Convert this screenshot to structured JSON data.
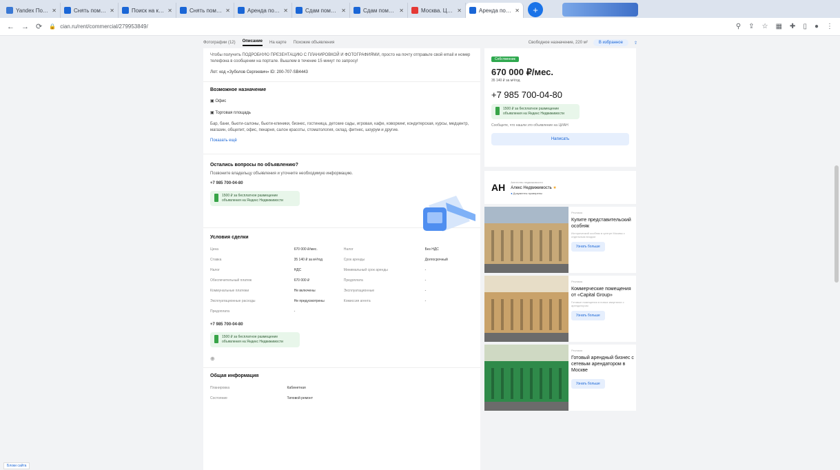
{
  "browser": {
    "tabs": [
      {
        "title": "Yandex Почта",
        "color": "#3a78d4"
      },
      {
        "title": "Снять помещение с...",
        "color": "#1a66d6"
      },
      {
        "title": "Поиск на карте ЦИАН",
        "color": "#1a66d6"
      },
      {
        "title": "Снять помещение с...",
        "color": "#1a66d6"
      },
      {
        "title": "Аренда помещени...",
        "color": "#1a66d6"
      },
      {
        "title": "Сдам помещение...",
        "color": "#1a66d6"
      },
      {
        "title": "Сдам помещение...",
        "color": "#1a66d6"
      },
      {
        "title": "Москва. ЦИАН...",
        "color": "#e53935"
      },
      {
        "title": "Аренда помещен...",
        "color": "#1a66d6"
      }
    ],
    "new_tab": "+",
    "url": "cian.ru/rent/commercial/279953849/"
  },
  "sticky_nav": {
    "items": [
      "Фотографии (12)",
      "Описание",
      "На карте",
      "Похожие объявления"
    ],
    "area": "Свободное назначение, 220 м²",
    "favorite_label": "В избранное"
  },
  "description": {
    "intro": "Чтобы получить ПОДРОБНУЮ ПРЕЗЕНТАЦИЮ С ПЛАНИРОВКОЙ И ФОТОГРАФИЯМИ, просто на почту отправьте свой email и номер телефона в сообщении на портале. Вышлем в течение 15 минут по запросу!",
    "id": "Лот: код «Зуболов Сергеевич» ID: 200-707-SB4443"
  },
  "usage": {
    "title": "Возможное назначение",
    "items": [
      "Офис",
      "Торговая площадь"
    ],
    "text": "Бар, бани, бьюти-салоны, бьюти-клиники, бизнес, гостиница, детские сады, игровая, кафе, коворкинг, кондитерская, курсы, медцентр, магазин, общепит, офис, пекарня, салон красоты, стоматология, склад, фитнес, шоурум и другие.",
    "more": "Показать ещё"
  },
  "questions": {
    "title": "Остались вопросы по объявлению?",
    "text": "Позвоните владельцу объявления и уточните необходимую информацию.",
    "phone": "+7 985 700-04-80",
    "cashback": "1500 ₽ за бесплатное размещение объявления на Яндекс Недвижимости"
  },
  "conditions": {
    "title": "Условия сделки",
    "rows": [
      [
        "Цена",
        "670 000 ₽/мес.",
        "Налог",
        "Без НДС"
      ],
      [
        "Ставка",
        "35 140 ₽ за м²/год",
        "Срок аренды",
        "Долгосрочный"
      ],
      [
        "Налог",
        "НДС",
        "Минимальный срок аренды",
        "-"
      ],
      [
        "Обеспечительный платеж",
        "670 000 ₽",
        "Предоплата",
        "-"
      ],
      [
        "Коммунальные платежи",
        "Не включены",
        "Эксплуатационные",
        "-"
      ],
      [
        "Эксплуатационные расходы",
        "Не предусмотрены",
        "Комиссия агента",
        "-"
      ],
      [
        "Предоплата",
        "-",
        "",
        ""
      ]
    ],
    "phone": "+7 985 700-04-80",
    "cashback": "1500 ₽ за бесплатное размещение объявления на Яндекс Недвижимости"
  },
  "general": {
    "title": "Общая информация",
    "rows": [
      [
        "Планировка",
        "Кабинетная"
      ],
      [
        "Состояние",
        "Типовой ремонт"
      ]
    ]
  },
  "price_card": {
    "badge": "Собственник",
    "price": "670 000 ₽/мес.",
    "per_meter": "35 140 ₽ за м²/год",
    "phone": "+7 985 700-04-80",
    "cashback": "1500 ₽ за бесплатное размещение объявления на Яндекс Недвижимости",
    "note": "Сообщите, что нашли это объявление на ЦИАН",
    "write_label": "Написать"
  },
  "agency": {
    "logo": "АН",
    "label": "Агентство недвижимости",
    "name": "Алекс Недвижимость",
    "verified": "Документы проверены"
  },
  "ads": [
    {
      "source": "Реклама",
      "title": "Купите представительский особняк",
      "body": "Исторический особняк в центре Москвы с отдельным входом",
      "button": "Узнать больше",
      "sky": "#a9b9c9",
      "wall": "#c8a978"
    },
    {
      "source": "Реклама",
      "title": "Коммерческие помещения от «Capital Group»",
      "body": "Готовые помещения в новых кварталах с арендатором",
      "button": "Узнать больше",
      "sky": "#e7ddc7",
      "wall": "#c9a26a"
    },
    {
      "source": "Реклама",
      "title": "Готовый арендный бизнес с сетевым арендатором в Москве",
      "body": "",
      "button": "Узнать больше",
      "sky": "#cfd9c3",
      "wall": "#2f8a4a"
    }
  ],
  "status": "Блоки сайта"
}
